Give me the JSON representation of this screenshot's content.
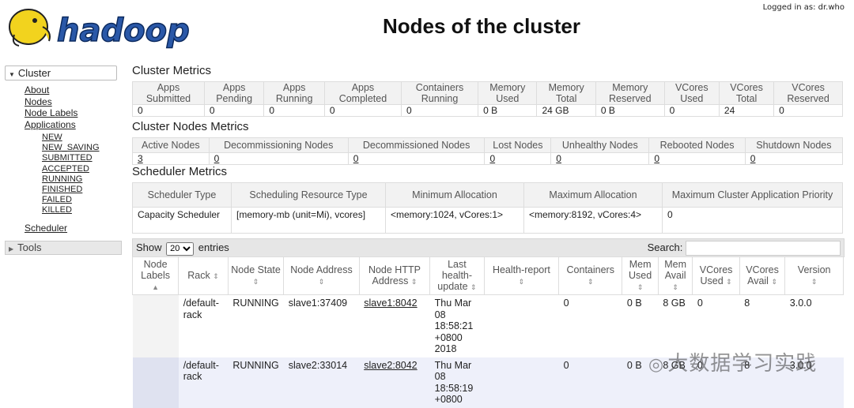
{
  "header": {
    "logo_text": "hadoop",
    "title": "Nodes of the cluster",
    "logged_in": "Logged in as: dr.who"
  },
  "sidebar": {
    "cluster_label": "Cluster",
    "items": [
      "About",
      "Nodes",
      "Node Labels",
      "Applications"
    ],
    "app_states": [
      "NEW",
      "NEW_SAVING",
      "SUBMITTED",
      "ACCEPTED",
      "RUNNING",
      "FINISHED",
      "FAILED",
      "KILLED"
    ],
    "scheduler_label": "Scheduler",
    "tools_label": "Tools"
  },
  "cluster_metrics": {
    "title": "Cluster Metrics",
    "headers": [
      [
        "Apps",
        "Submitted"
      ],
      [
        "Apps",
        "Pending"
      ],
      [
        "Apps",
        "Running"
      ],
      [
        "Apps",
        "Completed"
      ],
      [
        "Containers",
        "Running"
      ],
      [
        "Memory",
        "Used"
      ],
      [
        "Memory",
        "Total"
      ],
      [
        "Memory",
        "Reserved"
      ],
      [
        "VCores",
        "Used"
      ],
      [
        "VCores",
        "Total"
      ],
      [
        "VCores",
        "Reserved"
      ]
    ],
    "values": [
      "0",
      "0",
      "0",
      "0",
      "0",
      "0 B",
      "24 GB",
      "0 B",
      "0",
      "24",
      "0"
    ]
  },
  "cluster_nodes_metrics": {
    "title": "Cluster Nodes Metrics",
    "headers": [
      "Active Nodes",
      "Decommissioning Nodes",
      "Decommissioned Nodes",
      "Lost Nodes",
      "Unhealthy Nodes",
      "Rebooted Nodes",
      "Shutdown Nodes"
    ],
    "values": [
      "3",
      "0",
      "0",
      "0",
      "0",
      "0",
      "0"
    ]
  },
  "scheduler_metrics": {
    "title": "Scheduler Metrics",
    "headers": [
      "Scheduler Type",
      "Scheduling Resource Type",
      "Minimum Allocation",
      "Maximum Allocation",
      "Maximum Cluster Application Priority"
    ],
    "values": [
      "Capacity Scheduler",
      "[memory-mb (unit=Mi), vcores]",
      "<memory:1024, vCores:1>",
      "<memory:8192, vCores:4>",
      "0"
    ]
  },
  "nodes_table": {
    "show_label": "Show",
    "entries_value": "20",
    "entries_label": "entries",
    "search_label": "Search:",
    "search_value": "",
    "headers": [
      "Node Labels",
      "Rack",
      "Node State",
      "Node Address",
      "Node HTTP Address",
      "Last health-update",
      "Health-report",
      "Containers",
      "Mem Used",
      "Mem Avail",
      "VCores Used",
      "VCores Avail",
      "Version"
    ],
    "rows": [
      {
        "labels": "",
        "rack": "/default-rack",
        "state": "RUNNING",
        "address": "slave1:37409",
        "http": "slave1:8042",
        "last_update": "Thu Mar 08 18:58:21 +0800 2018",
        "health": "",
        "containers": "0",
        "mem_used": "0 B",
        "mem_avail": "8 GB",
        "vcores_used": "0",
        "vcores_avail": "8",
        "version": "3.0.0"
      },
      {
        "labels": "",
        "rack": "/default-rack",
        "state": "RUNNING",
        "address": "slave2:33014",
        "http": "slave2:8042",
        "last_update": "Thu Mar 08 18:58:19 +0800",
        "health": "",
        "containers": "0",
        "mem_used": "0 B",
        "mem_avail": "8 GB",
        "vcores_used": "0",
        "vcores_avail": "8",
        "version": "3.0.0"
      }
    ]
  },
  "watermark": "大数据学习实践"
}
